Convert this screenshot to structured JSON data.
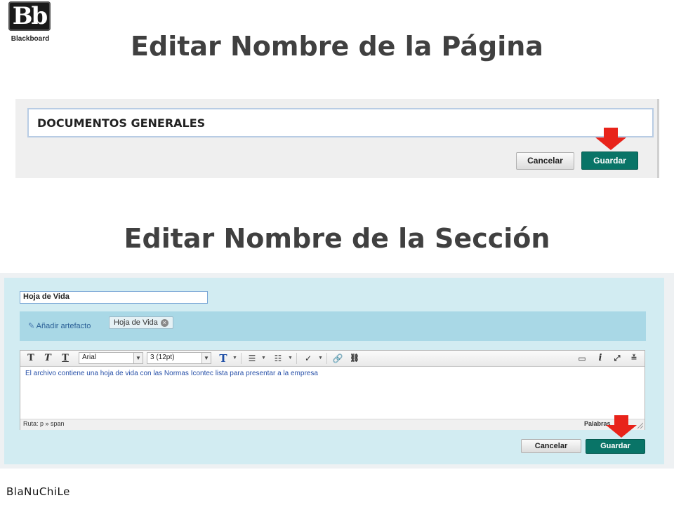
{
  "logo": {
    "mark": "Bb",
    "text": "Blackboard"
  },
  "section_page": {
    "heading": "Editar Nombre de la Página",
    "name_value": "DOCUMENTOS GENERALES",
    "cancel_label": "Cancelar",
    "save_label": "Guardar"
  },
  "section_section": {
    "heading": "Editar Nombre de la Sección",
    "name_value": "Hoja de Vida",
    "add_artifact_label": "Añadir artefacto",
    "artifact_chip_label": "Hoja de Vida",
    "editor": {
      "font_family": "Arial",
      "font_size": "3 (12pt)",
      "body_text": "El archivo contiene una hoja de vida con las Normas Icontec lista para presentar a la empresa",
      "path_label": "Ruta: p » span",
      "words_label": "Palabras"
    },
    "cancel_label": "Cancelar",
    "save_label": "Guardar"
  },
  "credit": "BlaNuChiLe",
  "colors": {
    "save_button": "#097467",
    "arrow": "#e8231a",
    "panel_bg": "#d2ecf2"
  }
}
